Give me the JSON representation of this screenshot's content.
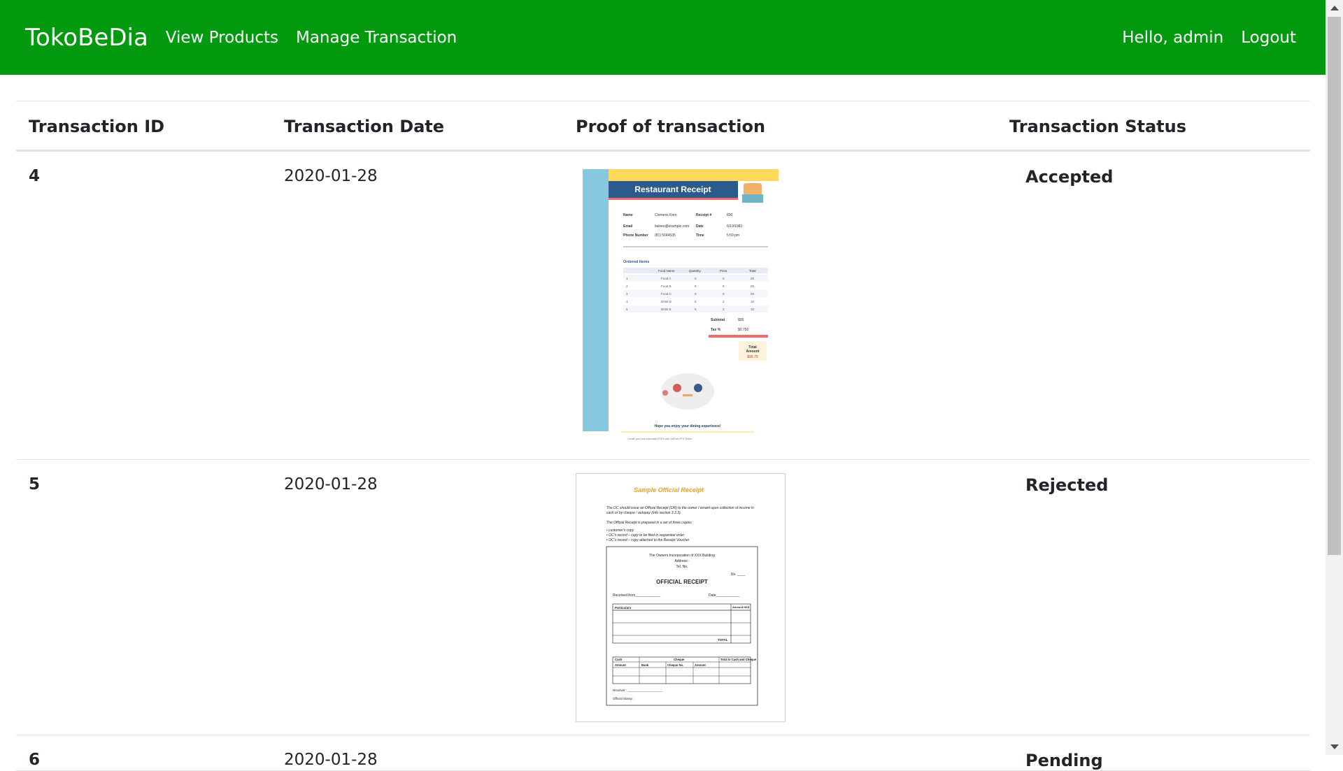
{
  "navbar": {
    "brand": "TokoBeDia",
    "links": [
      "View Products",
      "Manage Transaction"
    ],
    "greeting": "Hello, admin",
    "logout": "Logout",
    "background": "#039a0f"
  },
  "table": {
    "headers": [
      "Transaction ID",
      "Transaction Date",
      "Proof of transaction",
      "Transaction Status"
    ],
    "rows": [
      {
        "id": "4",
        "date": "2020-01-28",
        "status": "Accepted"
      },
      {
        "id": "5",
        "date": "2020-01-28",
        "status": "Rejected"
      },
      {
        "id": "6",
        "date": "2020-01-28",
        "status": "Pending"
      }
    ]
  },
  "receipt1": {
    "title": "Restaurant Receipt",
    "name_label": "Name",
    "name": "Clemens Korn",
    "receipt_label": "Receipt #",
    "receipt": "830",
    "email_label": "Email",
    "email": "balves@example.com",
    "date_label": "Date",
    "date": "6/19/1982",
    "phone_label": "Phone Number",
    "phone": "(81) 5044535",
    "time_label": "Time",
    "time": "5:59 pm",
    "ordered_label": "Ordered Items",
    "cols": [
      "Food Name",
      "Quantity",
      "Price",
      "Total"
    ],
    "items": [
      [
        "1",
        "Food A",
        "5",
        "5",
        "25"
      ],
      [
        "2",
        "Food B",
        "5",
        "5",
        "25"
      ],
      [
        "3",
        "Food C",
        "5",
        "5",
        "25"
      ],
      [
        "4",
        "Drink D",
        "5",
        "2",
        "10"
      ],
      [
        "5",
        "Drink E",
        "5",
        "2",
        "10"
      ]
    ],
    "subtotal_label": "Subtotal",
    "subtotal": "$95",
    "tax_label": "Tax %",
    "tax": "$0.750",
    "total_label": "Total Amount",
    "total": "$95.75",
    "footer": "Hope you enjoy your dining experience!",
    "credit": "Create your own automated PDFs with JotForm PDF Editor"
  },
  "receipt2": {
    "heading": "Sample Official Receipt",
    "line1": "The OC should issue an Official Receipt (OR) to the owner / tenant upon collection of income in",
    "line2": "cash or by cheque / autopay (Info section 3.3.3).",
    "line3": "The Official Receipt is prepared in a set of three copies :",
    "b1": "• customer's copy",
    "b2": "• OC's record – copy to be filed in sequential order",
    "b3": "• OC's record – copy attached to the Receipt Voucher",
    "org": "The Owners Incorporation of XXX Building",
    "address": "Address :",
    "tel": "Tel. No.",
    "no": "No. ____",
    "title": "OFFICIAL RECEIPT",
    "received": "Received from_____________",
    "date": "Date____________",
    "particulars": "Particulars",
    "amount": "Amount HK$",
    "total": "TOTAL",
    "cash": "Cash",
    "cheque": "Cheque",
    "total_cash": "Total in Cash and Cheque",
    "sub_amount": "Amount",
    "bank": "Bank",
    "cheque_no": "Cheque No.",
    "sub_amount2": "Amount",
    "receiver": "Receiver : ____________________",
    "stamp": "Official Stamp :"
  }
}
